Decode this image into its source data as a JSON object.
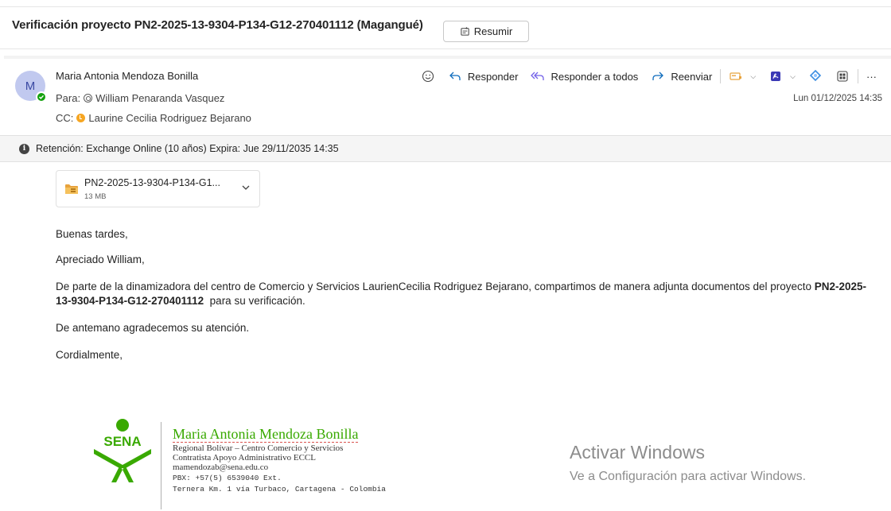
{
  "message": {
    "subject": "Verificación proyecto PN2-2025-13-9304-P134-G12-270401112 (Magangué)",
    "summarize_label": "Resumir"
  },
  "header": {
    "avatar_initial": "M",
    "sender": "Maria Antonia Mendoza Bonilla",
    "to_label": "Para:",
    "to_name": "William Penaranda Vasquez",
    "cc_label": "CC:",
    "cc_name": "Laurine Cecilia Rodriguez Bejarano",
    "date": "Lun 01/12/2025 14:35"
  },
  "toolbar": {
    "reply": "Responder",
    "reply_all": "Responder a todos",
    "forward": "Reenviar",
    "more": "···"
  },
  "retention": {
    "text": "Retención: Exchange Online (10 años) Expira: Jue 29/11/2035 14:35"
  },
  "attachment": {
    "name": "PN2-2025-13-9304-P134-G1...",
    "size": "13 MB"
  },
  "body": {
    "greeting": "Buenas tardes,",
    "salutation": "Apreciado William,",
    "para_prefix": "De parte de la dinamizadora del centro de Comercio y Servicios LaurienCecilia Rodriguez Bejarano, compartimos de manera adjunta documentos del proyecto ",
    "para_project": "PN2-2025-13-9304-P134-G12-270401112",
    "para_suffix": "  para su verificación.",
    "thanks": "De antemano agradecemos su atención.",
    "closing": "Cordialmente,"
  },
  "signature": {
    "logo_text": "SENA",
    "name": "Maria Antonia Mendoza Bonilla",
    "regional": "Regional Bolívar – Centro Comercio y Servicios",
    "role": "Contratista Apoyo Administrativo ECCL",
    "email": "mamendozab@sena.edu.co",
    "phone": "PBX: +57(5) 6539040 Ext.",
    "address": "Ternera Km. 1 vía Turbaco, Cartagena - Colombia"
  },
  "watermark": {
    "title": "Activar Windows",
    "subtitle": "Ve a Configuración para activar Windows."
  },
  "colors": {
    "accent": "#0f6cbd",
    "reply_all_purple": "#7160e8",
    "sena_green": "#39a900",
    "presence_green": "#13a10e",
    "away_orange": "#f6a623"
  },
  "icons": [
    "summarize-icon",
    "emoji-icon",
    "reply-icon",
    "reply-all-icon",
    "forward-icon",
    "tag-icon",
    "pdf-icon",
    "loop-icon",
    "apps-icon",
    "more-icon",
    "info-icon",
    "folder-zip-icon",
    "chevron-down-icon"
  ]
}
